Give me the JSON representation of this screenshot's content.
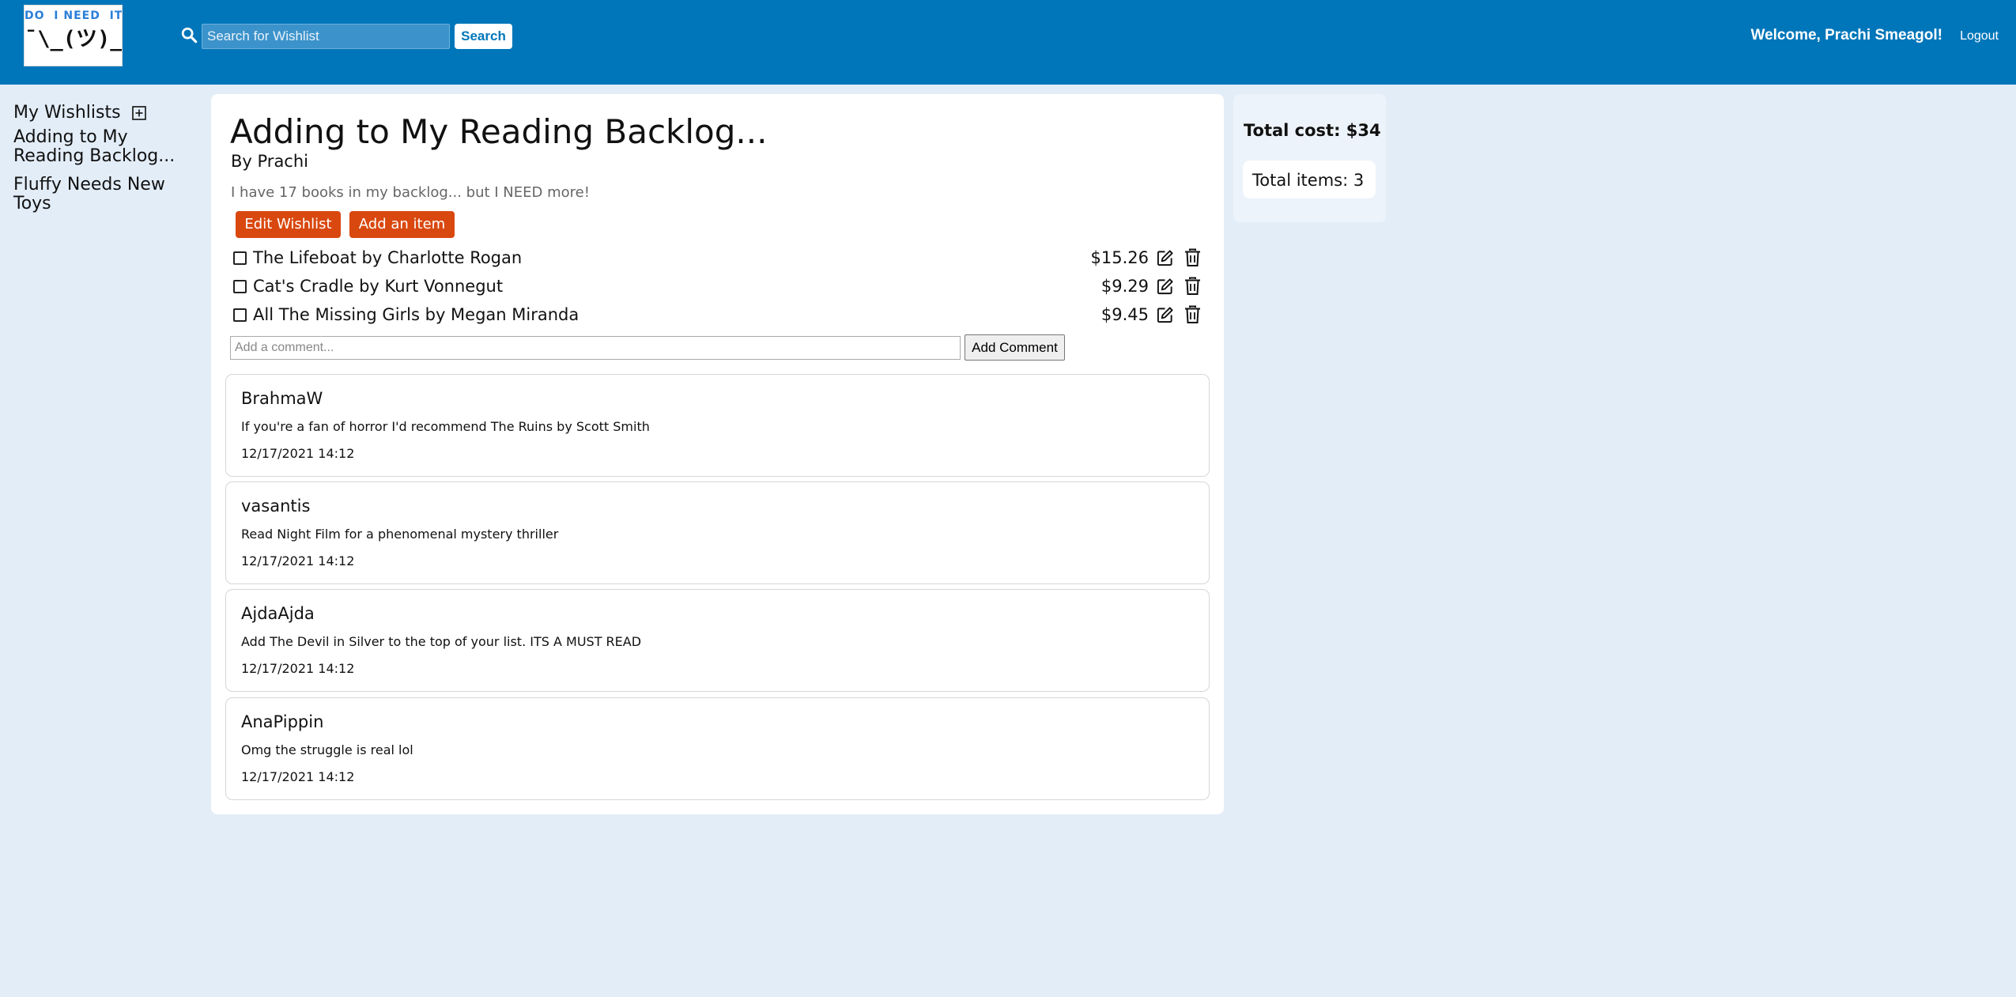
{
  "header": {
    "logo": {
      "top_text": "DO  I NEED  IT?",
      "shrug": "¯\\_(ツ)_/¯"
    },
    "search": {
      "placeholder": "Search for Wishlist",
      "button_label": "Search"
    },
    "welcome": "Welcome, Prachi Smeagol!",
    "logout_label": "Logout"
  },
  "sidebar": {
    "heading": "My Wishlists",
    "items": [
      {
        "label": "Adding to My Reading Backlog..."
      },
      {
        "label": "Fluffy Needs New Toys"
      }
    ]
  },
  "wishlist": {
    "title": "Adding to My Reading Backlog...",
    "byline": "By Prachi",
    "description": "I have 17 books in my backlog... but I NEED more!",
    "edit_button": "Edit Wishlist",
    "add_item_button": "Add an item",
    "items": [
      {
        "name": "The Lifeboat by Charlotte Rogan",
        "price": "$15.26",
        "checked": false
      },
      {
        "name": "Cat's Cradle by Kurt Vonnegut",
        "price": "$9.29",
        "checked": false
      },
      {
        "name": "All The Missing Girls by Megan Miranda",
        "price": "$9.45",
        "checked": false
      }
    ]
  },
  "comment_form": {
    "placeholder": "Add a comment...",
    "button_label": "Add Comment"
  },
  "comments": [
    {
      "author": "BrahmaW",
      "text": "If you're a fan of horror I'd recommend The Ruins by Scott Smith",
      "date": "12/17/2021 14:12"
    },
    {
      "author": "vasantis",
      "text": "Read Night Film for a phenomenal mystery thriller",
      "date": "12/17/2021 14:12"
    },
    {
      "author": "AjdaAjda",
      "text": "Add The Devil in Silver to the top of your list. ITS A MUST READ",
      "date": "12/17/2021 14:12"
    },
    {
      "author": "AnaPippin",
      "text": "Omg the struggle is real lol",
      "date": "12/17/2021 14:12"
    }
  ],
  "summary": {
    "total_cost": "Total cost: $34",
    "total_items": "Total items: 3"
  },
  "colors": {
    "header_bg": "#0076ba",
    "page_bg": "#e3edf8",
    "accent_button": "#d9480f"
  },
  "icons": [
    "search-icon",
    "plus-square-icon",
    "edit-icon",
    "trash-icon"
  ]
}
